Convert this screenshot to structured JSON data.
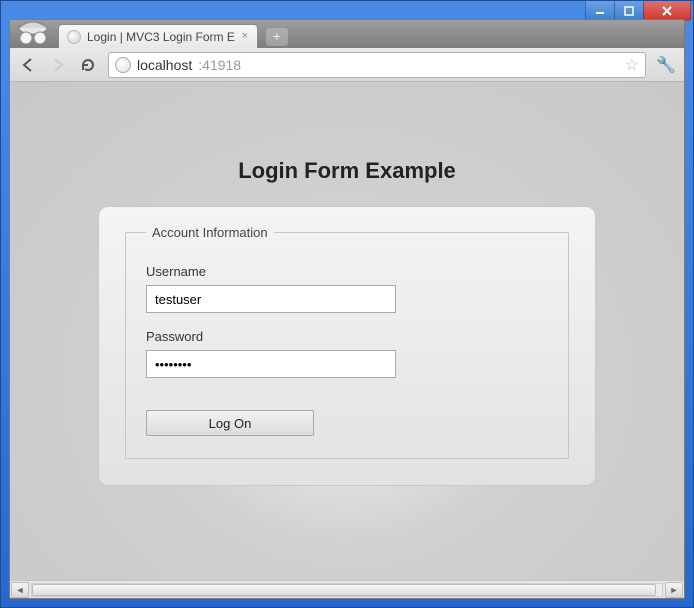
{
  "window": {
    "tab_title": "Login | MVC3 Login Form E",
    "url_host": "localhost",
    "url_port": ":41918"
  },
  "page": {
    "title": "Login Form Example",
    "fieldset_legend": "Account Information",
    "username_label": "Username",
    "username_value": "testuser",
    "password_label": "Password",
    "password_value": "password",
    "submit_label": "Log On"
  }
}
